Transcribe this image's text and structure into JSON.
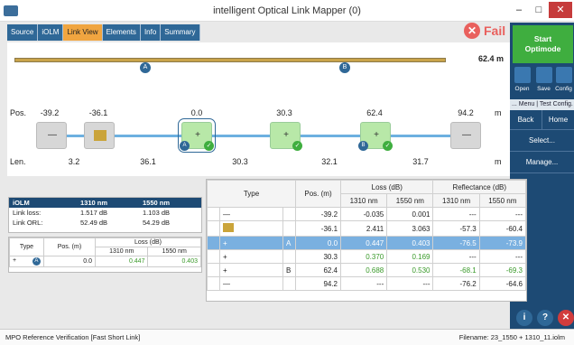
{
  "window": {
    "title": "intelligent Optical Link Mapper (0)",
    "min": "–",
    "max": "□",
    "close": "✕"
  },
  "tabs": [
    {
      "label": "Source"
    },
    {
      "label": "iOLM"
    },
    {
      "label": "Link View"
    },
    {
      "label": "Elements"
    },
    {
      "label": "Info"
    },
    {
      "label": "Summary"
    }
  ],
  "status": {
    "icon": "✕",
    "text": "Fail"
  },
  "right": {
    "start": "Start",
    "start2": "Optimode",
    "open": "Open",
    "save": "Save",
    "config": "Config",
    "menu_strip": "... Menu | Test Config.",
    "back": "Back",
    "home": "Home",
    "select": "Select...",
    "manage": "Manage..."
  },
  "link": {
    "length": "62.4 m",
    "bookmark_a": "A",
    "bookmark_b": "B",
    "pos_header": "Pos.",
    "len_header": "Len.",
    "unit": "m",
    "positions": [
      "-39.2",
      "-36.1",
      "0.0",
      "30.3",
      "62.4",
      "94.2"
    ],
    "lengths": [
      "3.2",
      "36.1",
      "30.3",
      "32.1",
      "31.7"
    ]
  },
  "summary": {
    "title": "iOLM",
    "w1": "1310 nm",
    "w2": "1550 nm",
    "rows": [
      {
        "label": "Link loss:",
        "v1": "1.517 dB",
        "v2": "1.103 dB"
      },
      {
        "label": "Link ORL:",
        "v1": "52.49 dB",
        "v2": "54.29 dB"
      }
    ]
  },
  "small_table": {
    "type": "Type",
    "pos": "Pos. (m)",
    "loss": "Loss (dB)",
    "w1": "1310 nm",
    "w2": "1550 nm",
    "badge": "A",
    "row_pos": "0.0",
    "row_l1": "0.447",
    "row_l2": "0.403"
  },
  "grid": {
    "type": "Type",
    "pos": "Pos. (m)",
    "loss": "Loss (dB)",
    "refl": "Reflectance (dB)",
    "w1": "1310 nm",
    "w2": "1550 nm",
    "rows": [
      {
        "badge": "",
        "pos": "-39.2",
        "l1": "-0.035",
        "l2": "0.001",
        "r1": "---",
        "r2": "---"
      },
      {
        "badge": "",
        "pos": "-36.1",
        "l1": "2.411",
        "l2": "3.063",
        "r1": "-57.3",
        "r2": "-60.4"
      },
      {
        "badge": "A",
        "pos": "0.0",
        "l1": "0.447",
        "l2": "0.403",
        "r1": "-76.5",
        "r2": "-73.9"
      },
      {
        "badge": "",
        "pos": "30.3",
        "l1": "0.370",
        "l2": "0.169",
        "r1": "---",
        "r2": "---"
      },
      {
        "badge": "B",
        "pos": "62.4",
        "l1": "0.688",
        "l2": "0.530",
        "r1": "-68.1",
        "r2": "-69.3"
      },
      {
        "badge": "",
        "pos": "94.2",
        "l1": "---",
        "l2": "---",
        "r1": "-76.2",
        "r2": "-64.6"
      }
    ]
  },
  "footer": {
    "left": "MPO Reference Verification [Fast Short Link]",
    "right": "Filename: 23_1550 + 1310_11.iolm"
  },
  "colors": {
    "accent": "#2f6897",
    "fail": "#e9605d",
    "pass": "#3fae3f",
    "active_tab": "#f0a540"
  }
}
